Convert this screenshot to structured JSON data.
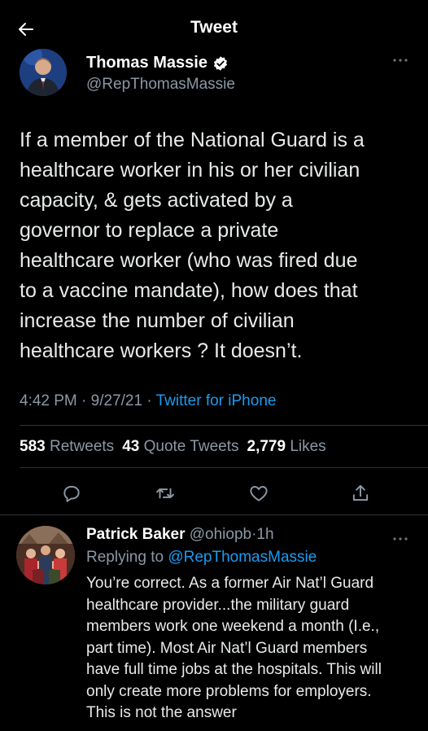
{
  "header": {
    "title": "Tweet",
    "back_icon": "arrow-left-icon"
  },
  "tweet": {
    "author_name": "Thomas Massie",
    "author_handle": "@RepThomasMassie",
    "verified": true,
    "text": "If a member of the National Guard is a\nhealthcare worker in his or her civilian\ncapacity, & gets activated by a\ngovernor to replace a private\nhealthcare worker (who was fired due\nto a vaccine mandate), how does that\nincrease the number of civilian\nhealthcare workers ? It doesn’t.",
    "time": "4:42 PM",
    "date": "9/27/21",
    "separator": "·",
    "source": "Twitter for iPhone",
    "retweets_count": "583",
    "retweets_label": "Retweets",
    "quotes_count": "43",
    "quotes_label": "Quote Tweets",
    "likes_count": "2,779",
    "likes_label": "Likes"
  },
  "actions": [
    "reply-icon",
    "retweet-icon",
    "like-icon",
    "share-icon"
  ],
  "reply": {
    "author_name": "Patrick Baker",
    "author_handle": "@ohiopb",
    "separator": "·",
    "age": "1h",
    "replying_label": "Replying to",
    "replying_to": "@RepThomasMassie",
    "text": "You’re correct.  As a former Air Nat’l Guard\nhealthcare provider...the military guard\nmembers work one weekend a month (I.e.,\npart time).  Most Air Nat’l Guard members\nhave full time jobs at the hospitals. This will\nonly create more problems for employers.\nThis is not the answer"
  },
  "colors": {
    "background": "#000000",
    "accent": "#1d9bf0",
    "muted": "#8b98a5",
    "text": "#e7e9ea"
  }
}
